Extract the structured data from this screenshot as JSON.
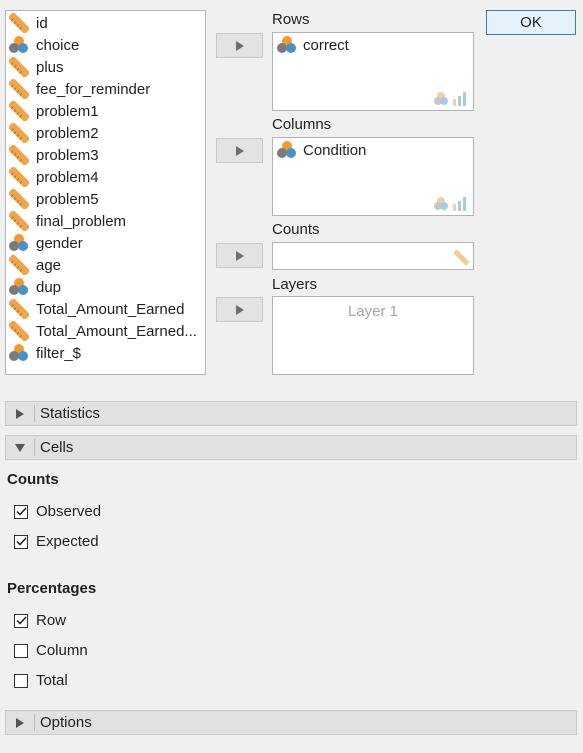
{
  "variables": [
    {
      "name": "id",
      "type": "scale"
    },
    {
      "name": "choice",
      "type": "nominal"
    },
    {
      "name": "plus",
      "type": "scale"
    },
    {
      "name": "fee_for_reminder",
      "type": "scale"
    },
    {
      "name": "problem1",
      "type": "scale"
    },
    {
      "name": "problem2",
      "type": "scale"
    },
    {
      "name": "problem3",
      "type": "scale"
    },
    {
      "name": "problem4",
      "type": "scale"
    },
    {
      "name": "problem5",
      "type": "scale"
    },
    {
      "name": "final_problem",
      "type": "scale"
    },
    {
      "name": "gender",
      "type": "nominal"
    },
    {
      "name": "age",
      "type": "scale"
    },
    {
      "name": "dup",
      "type": "nominal"
    },
    {
      "name": "Total_Amount_Earned",
      "type": "scale"
    },
    {
      "name": "Total_Amount_Earned...",
      "type": "scale"
    },
    {
      "name": "filter_$",
      "type": "nominal"
    }
  ],
  "ok_label": "OK",
  "rows": {
    "label": "Rows",
    "item": "correct"
  },
  "columns": {
    "label": "Columns",
    "item": "Condition"
  },
  "counts_box": {
    "label": "Counts"
  },
  "layers": {
    "label": "Layers",
    "placeholder": "Layer 1"
  },
  "sections": {
    "statistics": "Statistics",
    "cells": "Cells",
    "options": "Options"
  },
  "cells": {
    "counts_heading": "Counts",
    "observed": {
      "label": "Observed",
      "checked": true
    },
    "expected": {
      "label": "Expected",
      "checked": true
    },
    "percentages_heading": "Percentages",
    "row": {
      "label": "Row",
      "checked": true
    },
    "column": {
      "label": "Column",
      "checked": false
    },
    "total": {
      "label": "Total",
      "checked": false
    }
  },
  "colors": {
    "ruler": "#f0a54a",
    "nominal_orange": "#f39a2b",
    "nominal_blue": "#4a90c8",
    "nominal_grey": "#7a7a7a",
    "ok_border": "#3c7fb1"
  }
}
